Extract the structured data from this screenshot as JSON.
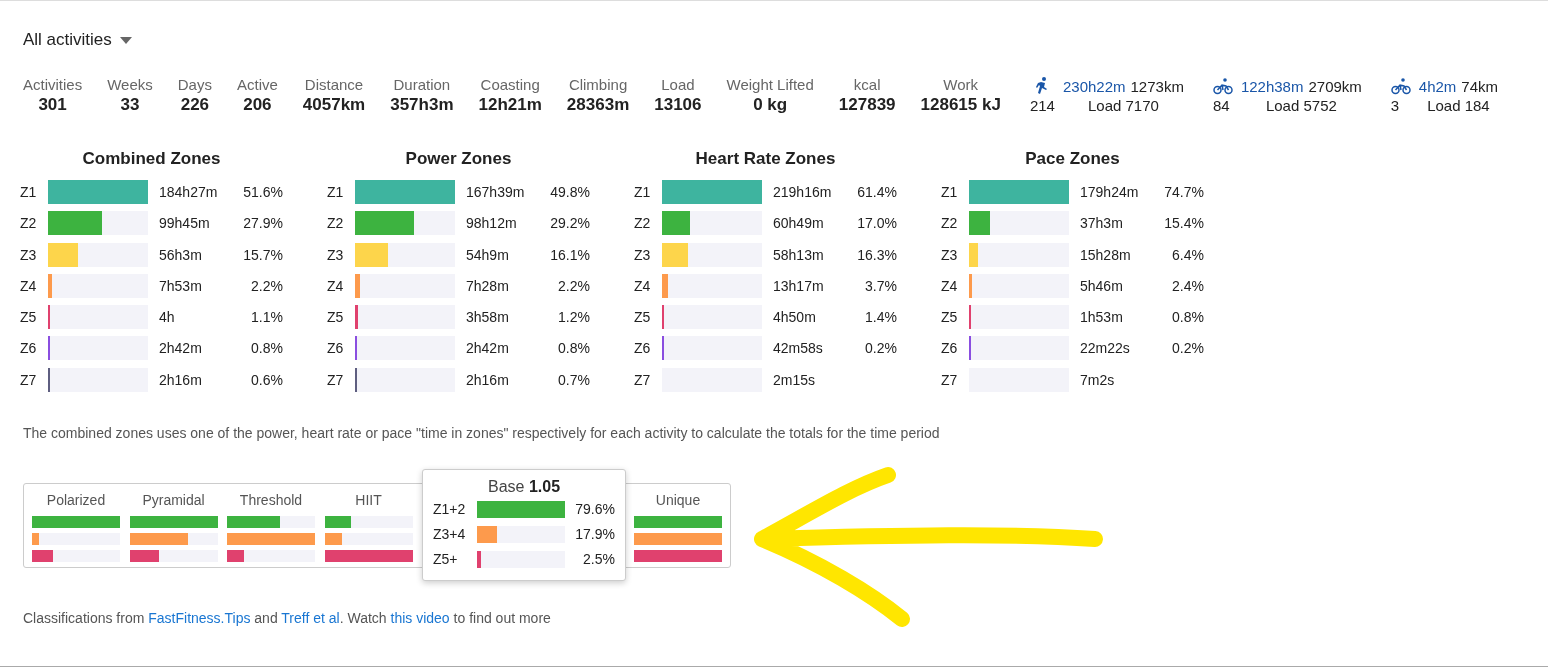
{
  "filter": {
    "label": "All activities"
  },
  "stats": [
    {
      "label": "Activities",
      "value": "301"
    },
    {
      "label": "Weeks",
      "value": "33"
    },
    {
      "label": "Days",
      "value": "226"
    },
    {
      "label": "Active",
      "value": "206"
    },
    {
      "label": "Distance",
      "value": "4057km"
    },
    {
      "label": "Duration",
      "value": "357h3m"
    },
    {
      "label": "Coasting",
      "value": "12h21m"
    },
    {
      "label": "Climbing",
      "value": "28363m"
    },
    {
      "label": "Load",
      "value": "13106"
    },
    {
      "label": "Weight Lifted",
      "value": "0 kg"
    },
    {
      "label": "kcal",
      "value": "127839"
    },
    {
      "label": "Work",
      "value": "128615 kJ"
    }
  ],
  "sports": [
    {
      "kind": "run",
      "time": "230h22m",
      "distance": "1273km",
      "count": "214",
      "load": "Load 7170"
    },
    {
      "kind": "ride",
      "time": "122h38m",
      "distance": "2709km",
      "count": "84",
      "load": "Load 5752"
    },
    {
      "kind": "ride",
      "time": "4h2m",
      "distance": "74km",
      "count": "3",
      "load": "Load 184"
    }
  ],
  "zone_tables": [
    {
      "title": "Combined Zones",
      "rows": [
        {
          "zone": "Z1",
          "time": "184h27m",
          "percent": "51.6%",
          "level": 1,
          "color": "#3eb49f"
        },
        {
          "zone": "Z2",
          "time": "99h45m",
          "percent": "27.9%",
          "level": 0.54,
          "color": "#3db340"
        },
        {
          "zone": "Z3",
          "time": "56h3m",
          "percent": "15.7%",
          "level": 0.3,
          "color": "#fdd54b"
        },
        {
          "zone": "Z4",
          "time": "7h53m",
          "percent": "2.2%",
          "level": 0.04,
          "color": "#fd9a4c"
        },
        {
          "zone": "Z5",
          "time": "4h",
          "percent": "1.1%",
          "level": 0.02,
          "color": "#e0416e"
        },
        {
          "zone": "Z6",
          "time": "2h42m",
          "percent": "0.8%",
          "level": 0.015,
          "color": "#8a4ee0"
        },
        {
          "zone": "Z7",
          "time": "2h16m",
          "percent": "0.6%",
          "level": 0.01,
          "color": "#5e5e80"
        }
      ]
    },
    {
      "title": "Power Zones",
      "rows": [
        {
          "zone": "Z1",
          "time": "167h39m",
          "percent": "49.8%",
          "level": 1,
          "color": "#3eb49f"
        },
        {
          "zone": "Z2",
          "time": "98h12m",
          "percent": "29.2%",
          "level": 0.59,
          "color": "#3db340"
        },
        {
          "zone": "Z3",
          "time": "54h9m",
          "percent": "16.1%",
          "level": 0.33,
          "color": "#fdd54b"
        },
        {
          "zone": "Z4",
          "time": "7h28m",
          "percent": "2.2%",
          "level": 0.05,
          "color": "#fd9a4c"
        },
        {
          "zone": "Z5",
          "time": "3h58m",
          "percent": "1.2%",
          "level": 0.025,
          "color": "#e0416e"
        },
        {
          "zone": "Z6",
          "time": "2h42m",
          "percent": "0.8%",
          "level": 0.016,
          "color": "#8a4ee0"
        },
        {
          "zone": "Z7",
          "time": "2h16m",
          "percent": "0.7%",
          "level": 0.014,
          "color": "#5e5e80"
        }
      ]
    },
    {
      "title": "Heart Rate Zones",
      "rows": [
        {
          "zone": "Z1",
          "time": "219h16m",
          "percent": "61.4%",
          "level": 1,
          "color": "#3eb49f"
        },
        {
          "zone": "Z2",
          "time": "60h49m",
          "percent": "17.0%",
          "level": 0.28,
          "color": "#3db340"
        },
        {
          "zone": "Z3",
          "time": "58h13m",
          "percent": "16.3%",
          "level": 0.26,
          "color": "#fdd54b"
        },
        {
          "zone": "Z4",
          "time": "13h17m",
          "percent": "3.7%",
          "level": 0.06,
          "color": "#fd9a4c"
        },
        {
          "zone": "Z5",
          "time": "4h50m",
          "percent": "1.4%",
          "level": 0.02,
          "color": "#e0416e"
        },
        {
          "zone": "Z6",
          "time": "42m58s",
          "percent": "0.2%",
          "level": 0.008,
          "color": "#8a4ee0"
        },
        {
          "zone": "Z7",
          "time": "2m15s"
        }
      ]
    },
    {
      "title": "Pace Zones",
      "rows": [
        {
          "zone": "Z1",
          "time": "179h24m",
          "percent": "74.7%",
          "level": 1,
          "color": "#3eb49f"
        },
        {
          "zone": "Z2",
          "time": "37h3m",
          "percent": "15.4%",
          "level": 0.21,
          "color": "#3db340"
        },
        {
          "zone": "Z3",
          "time": "15h28m",
          "percent": "6.4%",
          "level": 0.09,
          "color": "#fdd54b"
        },
        {
          "zone": "Z4",
          "time": "5h46m",
          "percent": "2.4%",
          "level": 0.03,
          "color": "#fd9a4c"
        },
        {
          "zone": "Z5",
          "time": "1h53m",
          "percent": "0.8%",
          "level": 0.01,
          "color": "#e0416e"
        },
        {
          "zone": "Z6",
          "time": "22m22s",
          "percent": "0.2%",
          "level": 0.008,
          "color": "#8a4ee0"
        },
        {
          "zone": "Z7",
          "time": "7m2s"
        }
      ]
    }
  ],
  "note": "The combined zones uses one of the power, heart rate or pace \"time in zones\" respectively for each activity to calculate the totals for the time period",
  "classifications": {
    "columns": [
      {
        "label": "Polarized",
        "bars": [
          {
            "level": 1,
            "color": "#3db340"
          },
          {
            "level": 0.08,
            "color": "#fd9a4c"
          },
          {
            "level": 0.24,
            "color": "#e0416e"
          }
        ]
      },
      {
        "label": "Pyramidal",
        "bars": [
          {
            "level": 1,
            "color": "#3db340"
          },
          {
            "level": 0.66,
            "color": "#fd9a4c"
          },
          {
            "level": 0.33,
            "color": "#e0416e"
          }
        ]
      },
      {
        "label": "Threshold",
        "bars": [
          {
            "level": 0.6,
            "color": "#3db340"
          },
          {
            "level": 1,
            "color": "#fd9a4c"
          },
          {
            "level": 0.19,
            "color": "#e0416e"
          }
        ]
      },
      {
        "label": "HIIT",
        "bars": [
          {
            "level": 0.3,
            "color": "#3db340"
          },
          {
            "level": 0.2,
            "color": "#fd9a4c"
          },
          {
            "level": 1,
            "color": "#e0416e"
          }
        ]
      },
      {
        "label": "Unique",
        "bars": [
          {
            "level": 1,
            "color": "#3db340"
          },
          {
            "level": 1,
            "color": "#fd9a4c"
          },
          {
            "level": 1,
            "color": "#e0416e"
          }
        ]
      }
    ],
    "tooltip": {
      "title": "Base **1.05**",
      "rows": [
        {
          "zone": "Z1+2",
          "percent": "79.6%",
          "level": 1,
          "color": "#3db340"
        },
        {
          "zone": "Z3+4",
          "percent": "17.9%",
          "level": 0.23,
          "color": "#fd9a4c"
        },
        {
          "zone": "Z5+",
          "percent": "2.5%",
          "level": 0.04,
          "color": "#e0416e"
        }
      ]
    }
  },
  "footer": [
    {
      "text": "Classifications from ",
      "link": false
    },
    {
      "text": "FastFitness.Tips",
      "link": true
    },
    {
      "text": " and ",
      "link": false
    },
    {
      "text": "Treff et al",
      "link": true
    },
    {
      "text": ". Watch ",
      "link": false
    },
    {
      "text": "this video",
      "link": true
    },
    {
      "text": " to find out more",
      "link": false
    }
  ]
}
